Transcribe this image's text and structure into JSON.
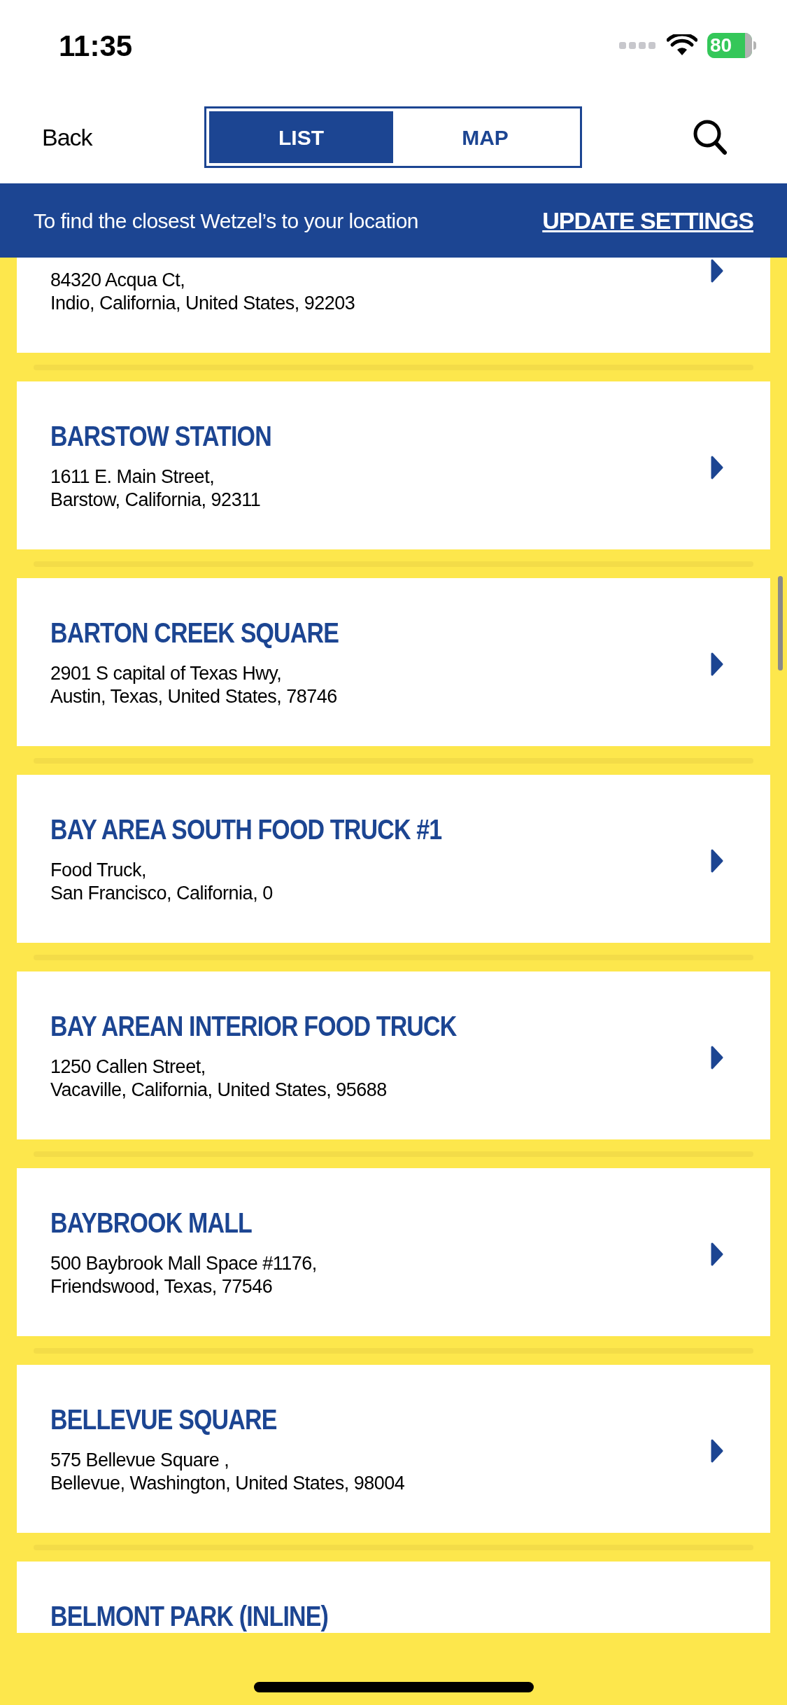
{
  "status_bar": {
    "time": "11:35",
    "battery": "80"
  },
  "nav": {
    "back": "Back",
    "tabs": [
      {
        "label": "LIST",
        "selected": true
      },
      {
        "label": "MAP",
        "selected": false
      }
    ]
  },
  "banner": {
    "text": "To find the closest Wetzel’s to your location",
    "action": "UPDATE SETTINGS"
  },
  "stores": [
    {
      "address": [
        "84320 Acqua Ct,",
        "Indio, California, United States, 92203"
      ]
    },
    {
      "name": "BARSTOW STATION",
      "address": [
        "1611 E. Main Street,",
        "Barstow, California, 92311"
      ]
    },
    {
      "name": "BARTON CREEK SQUARE",
      "address": [
        "2901 S capital of Texas Hwy,",
        "Austin, Texas, United States, 78746"
      ]
    },
    {
      "name": "BAY AREA SOUTH FOOD TRUCK #1",
      "address": [
        "Food Truck,",
        "San Francisco, California, 0"
      ]
    },
    {
      "name": "BAY AREAN INTERIOR FOOD TRUCK",
      "address": [
        "1250 Callen Street,",
        "Vacaville, California, United States, 95688"
      ]
    },
    {
      "name": "BAYBROOK MALL",
      "address": [
        "500 Baybrook Mall Space #1176,",
        "Friendswood, Texas, 77546"
      ]
    },
    {
      "name": "BELLEVUE SQUARE",
      "address": [
        "575 Bellevue Square ,",
        "Bellevue, Washington, United States, 98004"
      ]
    },
    {
      "name": "BELMONT PARK (INLINE)"
    }
  ]
}
